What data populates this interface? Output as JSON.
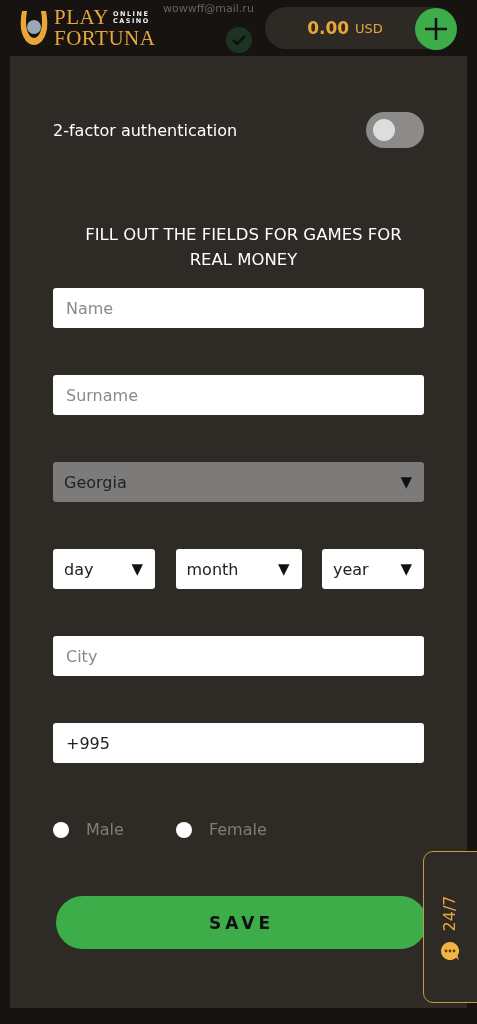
{
  "header": {
    "logo": {
      "play": "PLAY",
      "online": "ONLINE",
      "casino": "CASINO",
      "fortuna": "FORTUNA"
    },
    "email": "wowwff@mail.ru",
    "balance": {
      "amount": "0.00",
      "currency": "USD"
    }
  },
  "two_factor": {
    "label": "2-factor authentication",
    "on": false
  },
  "form": {
    "title": "FILL OUT THE FIELDS FOR GAMES FOR REAL MONEY",
    "fields": [
      {
        "kind": "input",
        "placeholder": "Name"
      },
      {
        "kind": "input",
        "placeholder": "Surname"
      },
      {
        "kind": "select",
        "value": "Georgia",
        "disabled": true
      },
      {
        "kind": "date",
        "parts": [
          {
            "value": "day"
          },
          {
            "value": "month"
          },
          {
            "value": "year"
          }
        ]
      },
      {
        "kind": "input",
        "placeholder": "City"
      },
      {
        "kind": "input",
        "value": "+995"
      }
    ],
    "gender": [
      {
        "label": "Male",
        "selected": false
      },
      {
        "label": "Female",
        "selected": false
      }
    ],
    "caret": "▼",
    "save": "SAVE"
  },
  "support": {
    "label": "24/7"
  }
}
